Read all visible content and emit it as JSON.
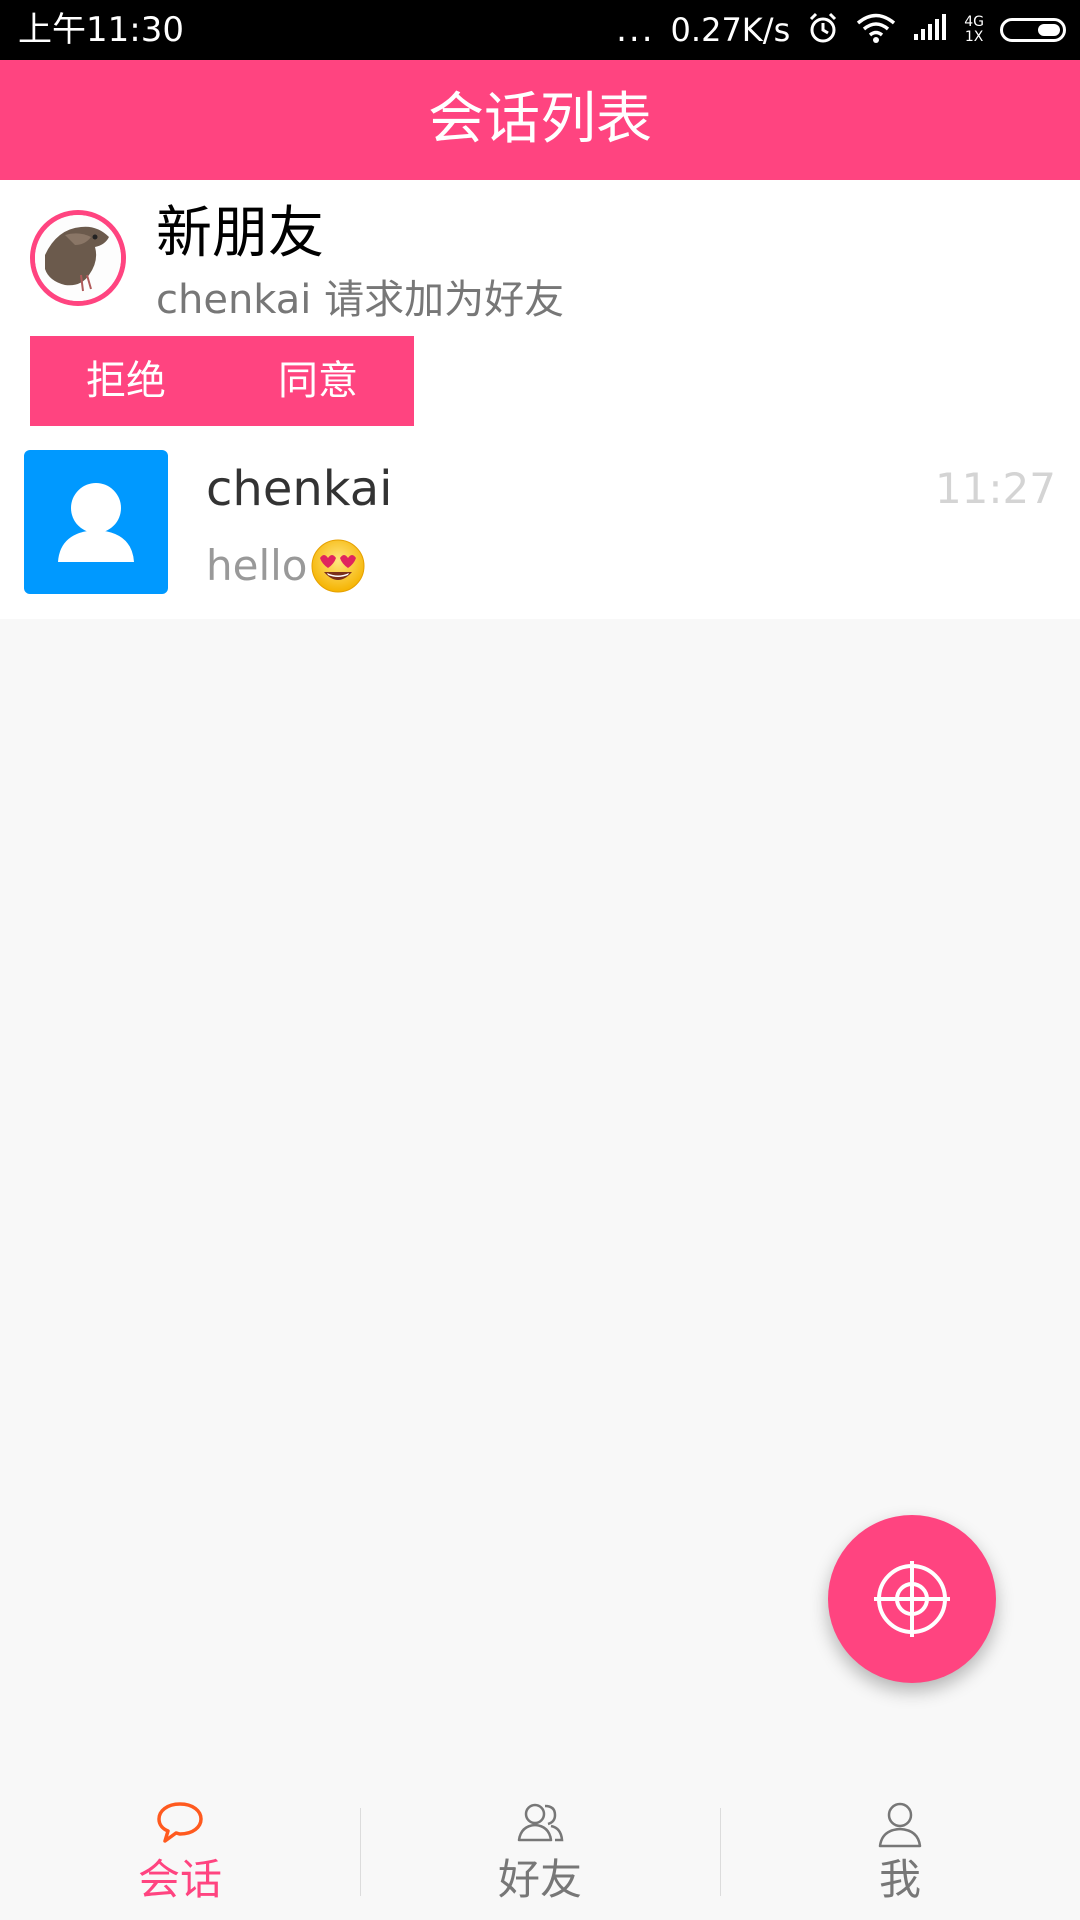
{
  "status_bar": {
    "time": "上午11:30",
    "dots": "...",
    "speed": "0.27K/s",
    "network_top": "4G",
    "network_bottom": "1X",
    "icons": [
      "alarm-icon",
      "wifi-icon",
      "signal-icon",
      "battery-icon"
    ]
  },
  "app_bar": {
    "title": "会话列表"
  },
  "new_friend": {
    "title": "新朋友",
    "subtitle": "chenkai 请求加为好友",
    "reject_label": "拒绝",
    "accept_label": "同意"
  },
  "conversations": [
    {
      "name": "chenkai",
      "time": "11:27",
      "message": "hello",
      "emoji": "heart-eyes-emoji"
    }
  ],
  "bottom_nav": {
    "items": [
      {
        "label": "会话",
        "icon": "chat-bubble-icon",
        "active": true
      },
      {
        "label": "好友",
        "icon": "friends-icon",
        "active": false
      },
      {
        "label": "我",
        "icon": "user-icon",
        "active": false
      }
    ]
  },
  "colors": {
    "accent": "#ff4480",
    "avatar_blue": "#0099ff",
    "active_icon": "#ff5a1f"
  }
}
